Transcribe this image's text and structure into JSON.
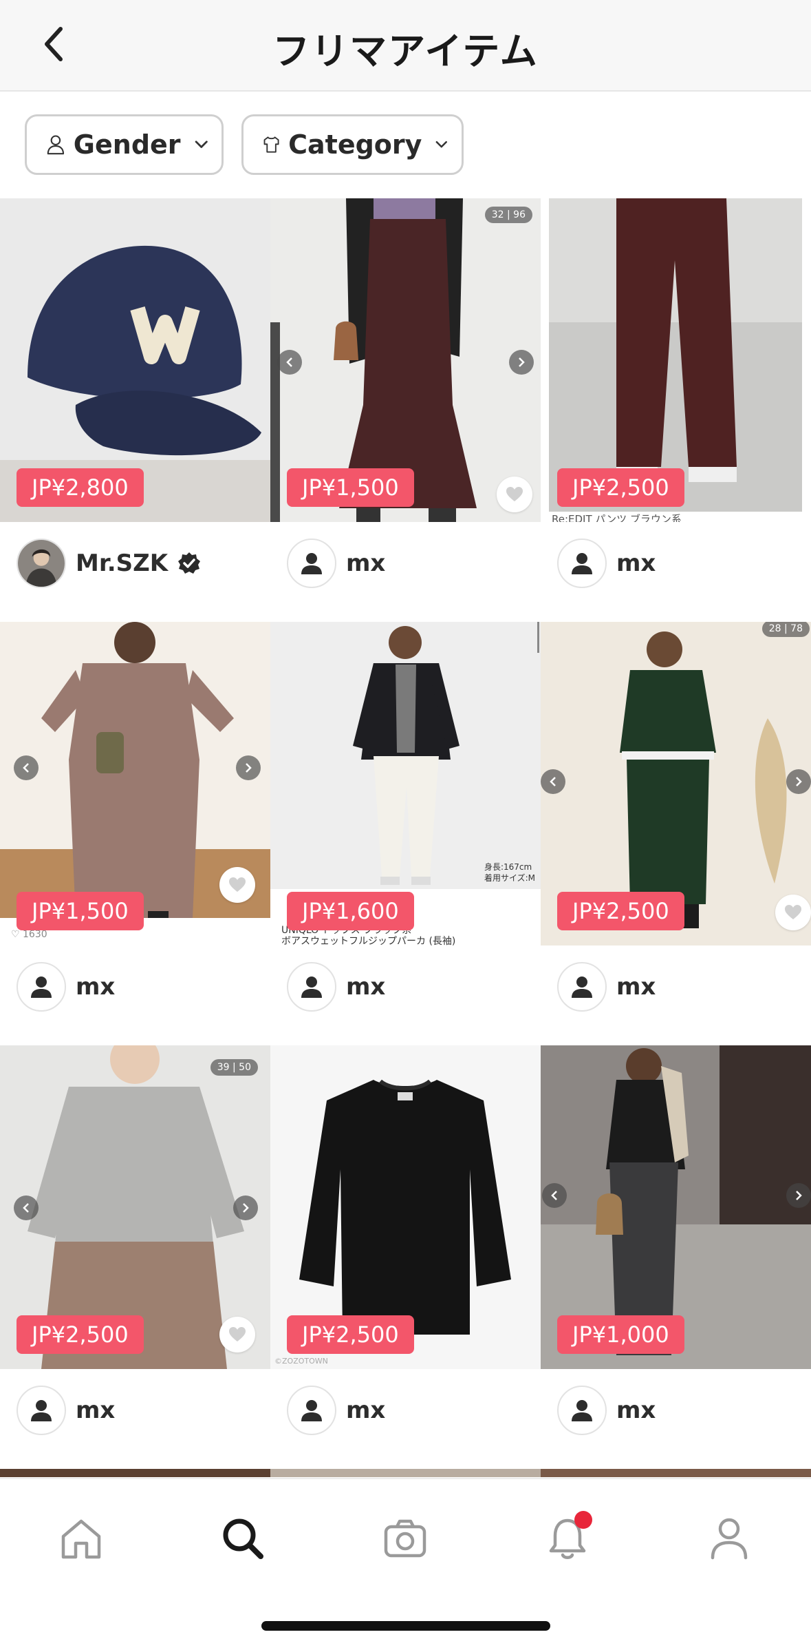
{
  "header": {
    "title": "フリマアイテム"
  },
  "filters": {
    "gender_label": "Gender",
    "category_label": "Category"
  },
  "items": [
    {
      "price": "JP¥2,800",
      "user": "Mr.SZK",
      "verified": true
    },
    {
      "price": "JP¥1,500",
      "user": "mx",
      "badge": "32 | 96"
    },
    {
      "price": "JP¥2,500",
      "user": "mx",
      "caption": "Re:EDIT パンツ ブラウン系"
    },
    {
      "price": "JP¥1,500",
      "user": "mx",
      "likes": "♡ 1630"
    },
    {
      "price": "JP¥1,600",
      "user": "mx",
      "caption": "UNIQLO トップス ブラック系",
      "caption2": "ボアスウェットフルジップパーカ (長袖)",
      "photo_note": "身長:167cm",
      "photo_note2": "着用サイズ:M"
    },
    {
      "price": "JP¥2,500",
      "user": "mx",
      "badge": "28 | 78"
    },
    {
      "price": "JP¥2,500",
      "user": "mx",
      "badge": "39 | 50"
    },
    {
      "price": "JP¥2,500",
      "user": "mx",
      "watermark": "©ZOZOTOWN"
    },
    {
      "price": "JP¥1,000",
      "user": "mx"
    }
  ],
  "colors": {
    "price_bg": "#f3566a",
    "notification_dot": "#e8263a"
  },
  "tabbar": {
    "icons": [
      "home-icon",
      "search-icon",
      "camera-icon",
      "bell-icon",
      "profile-icon"
    ],
    "active": "search-icon"
  }
}
